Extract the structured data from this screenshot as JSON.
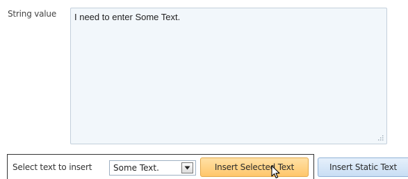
{
  "field": {
    "label": "String value",
    "value": "I need to enter Some Text."
  },
  "insert_bar": {
    "label": "Select text to insert",
    "selected_option": "Some Text.",
    "insert_selected_label": "Insert Selected Text",
    "insert_static_label": "Insert Static Text"
  },
  "colors": {
    "textarea_bg": "#f2f7fb",
    "selected_button_bg": "#ffc76b",
    "static_button_bg": "#c9def4"
  },
  "icons": {
    "dropdown": "chevron-down-icon",
    "resize": "resize-grip-icon",
    "pointer": "mouse-cursor-icon"
  }
}
